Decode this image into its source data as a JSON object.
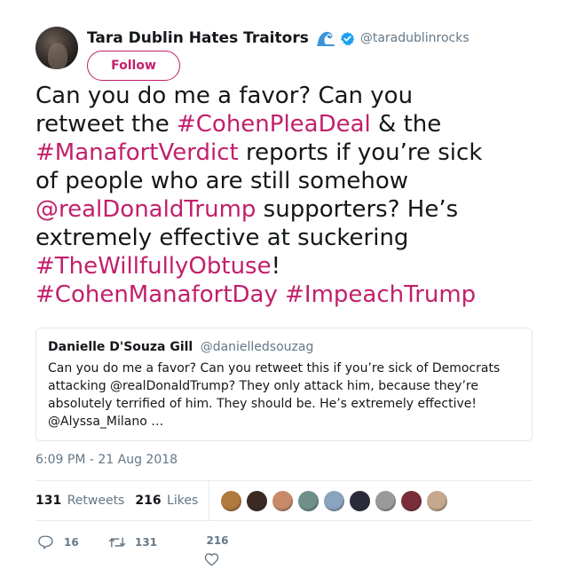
{
  "author": {
    "display_name": "Tara Dublin Hates Traitors",
    "handle": "@taradublinrocks",
    "emoji_icon": "water-wave-icon",
    "verified": true
  },
  "follow_label": "Follow",
  "tweet": {
    "lines": [
      [
        {
          "t": "Can you do me a favor? Can you",
          "link": false
        }
      ],
      [
        {
          "t": "retweet the ",
          "link": false
        },
        {
          "t": "#CohenPleaDeal",
          "link": true
        },
        {
          "t": " & the",
          "link": false
        }
      ],
      [
        {
          "t": "#ManafortVerdict",
          "link": true
        },
        {
          "t": " reports if you’re sick",
          "link": false
        }
      ],
      [
        {
          "t": "of people who are still somehow",
          "link": false
        }
      ],
      [
        {
          "t": "@realDonaldTrump",
          "link": true
        },
        {
          "t": " supporters? He’s",
          "link": false
        }
      ],
      [
        {
          "t": "extremely effective at suckering",
          "link": false
        }
      ],
      [
        {
          "t": "#TheWillfullyObtuse",
          "link": true
        },
        {
          "t": "!",
          "link": false
        }
      ],
      [
        {
          "t": "#CohenManafortDay",
          "link": true
        },
        {
          "t": " ",
          "link": false
        },
        {
          "t": "#ImpeachTrump",
          "link": true
        }
      ]
    ]
  },
  "quoted": {
    "name": "Danielle D'Souza Gill",
    "handle": "@danielledsouzag",
    "lines": [
      "Can you do me a favor? Can you retweet this if you’re sick of Democrats",
      "attacking @realDonaldTrump? They only attack him, because they’re",
      "absolutely terrified of him. They should be. He’s extremely effective!",
      "@Alyssa_Milano …"
    ]
  },
  "timestamp": "6:09 PM - 21 Aug 2018",
  "stats": {
    "retweets_count": "131",
    "retweets_label": "Retweets",
    "likes_count": "216",
    "likes_label": "Likes"
  },
  "likers": [
    "#b07a3c",
    "#3a2a22",
    "#c98a6a",
    "#6f8f8a",
    "#8aa4c0",
    "#2a2b3a",
    "#9a9a9a",
    "#7a2e3a",
    "#c4a78c"
  ],
  "actions": {
    "reply_count": "16",
    "retweet_count": "131",
    "like_count": "216"
  },
  "colors": {
    "accent": "#c21f6b",
    "secondary_text": "#657786",
    "verified": "#1da1f2"
  }
}
